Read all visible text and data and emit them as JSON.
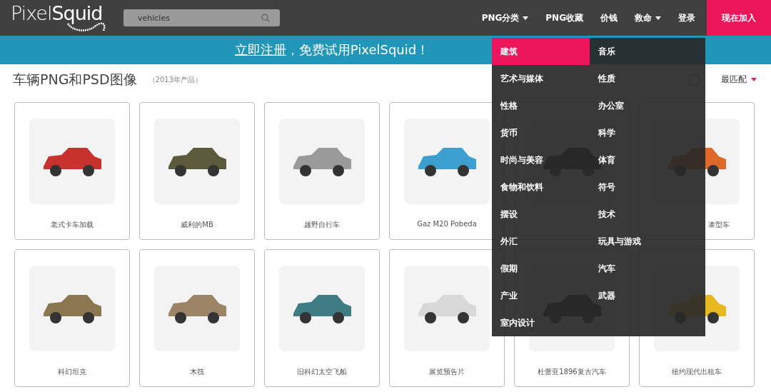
{
  "header": {
    "logo": "Pixel**Squid**",
    "search": {
      "value": "vehicles"
    },
    "nav": [
      {
        "label": "PNG分类",
        "dropdown": true
      },
      {
        "label": "PNG收藏",
        "dropdown": false
      },
      {
        "label": "价钱",
        "dropdown": false
      },
      {
        "label": "救命",
        "dropdown": true
      },
      {
        "label": "登录",
        "dropdown": false
      }
    ],
    "join_button": "现在加入"
  },
  "banner": {
    "link": "立即注册",
    "text": "，免费试用PixelSquid！"
  },
  "page": {
    "title": "车辆PNG和PSD图像",
    "subtitle": "（2013年产品）",
    "editorial": {
      "checked": false
    },
    "sort_value": "最匹配"
  },
  "products": [
    {
      "name": "老式卡车加载",
      "color": "#c8322e"
    },
    {
      "name": "威利的MB",
      "color": "#5c5a3c"
    },
    {
      "name": "越野自行车",
      "color": "#9a9a9a"
    },
    {
      "name": "Gaz M20 Pobeda",
      "color": "#3d9fd0"
    },
    {
      "color": "#2a2a2a"
    },
    {
      "name": "凑型车",
      "cut": true,
      "color": "#e0672a"
    },
    {
      "name": "科幻坦克",
      "color": "#8a7650"
    },
    {
      "name": "木筏",
      "color": "#9c8466"
    },
    {
      "name": "旧科幻太空飞船",
      "color": "#3f7c84"
    },
    {
      "name": "展览预告片",
      "color": "#d8d8d8"
    },
    {
      "name": "杜蕾亚1896复古汽车",
      "color": "#222222"
    },
    {
      "name": "纽约现代出租车",
      "color": "#e8b820"
    }
  ],
  "menu": [
    {
      "label": "建筑",
      "selected": true
    },
    {
      "label": "艺术与媒体",
      "selected": false
    },
    {
      "label": "性格",
      "selected": false
    },
    {
      "label": "货币",
      "selected": false
    },
    {
      "label": "时尚与美容",
      "selected": false
    },
    {
      "label": "食物和饮料",
      "selected": false
    },
    {
      "label": "摆设",
      "selected": false
    },
    {
      "label": "外汇",
      "selected": false
    },
    {
      "label": "假期",
      "selected": false
    },
    {
      "label": "产业",
      "selected": false
    },
    {
      "label": "室内设计",
      "selected": false
    },
    {
      "label": "音乐",
      "selected": false
    },
    {
      "label": "性质",
      "selected": false
    },
    {
      "label": "办公室",
      "selected": false
    },
    {
      "label": "科学",
      "selected": false
    },
    {
      "label": "体育",
      "selected": false
    },
    {
      "label": "符号",
      "selected": false
    },
    {
      "label": "技术",
      "selected": false
    },
    {
      "label": "玩具与游戏",
      "selected": false
    },
    {
      "label": "汽车",
      "selected": false
    },
    {
      "label": "武器",
      "selected": false
    }
  ]
}
